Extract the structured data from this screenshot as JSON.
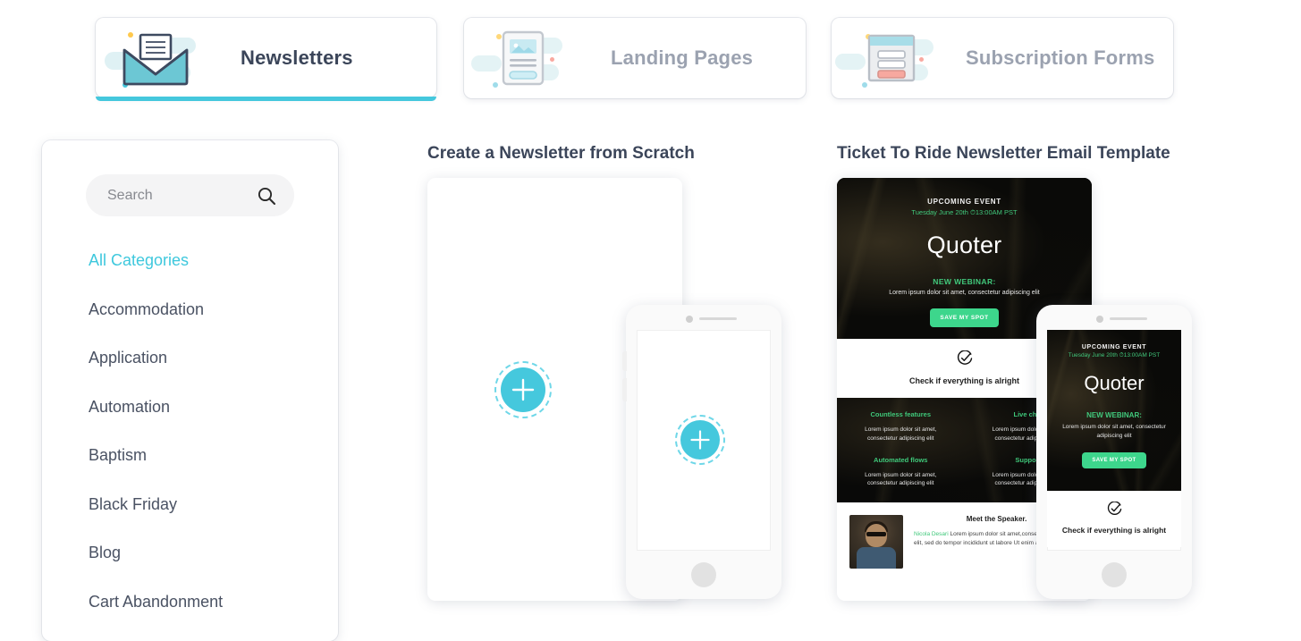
{
  "tabs": [
    {
      "label": "Newsletters",
      "icon": "envelope-icon",
      "active": true
    },
    {
      "label": "Landing Pages",
      "icon": "document-image-icon",
      "active": false
    },
    {
      "label": "Subscription Forms",
      "icon": "form-window-icon",
      "active": false
    }
  ],
  "sidebar": {
    "search": {
      "placeholder": "Search",
      "value": "",
      "icon": "search-icon"
    },
    "categories": [
      {
        "label": "All Categories",
        "active": true
      },
      {
        "label": "Accommodation",
        "active": false
      },
      {
        "label": "Application",
        "active": false
      },
      {
        "label": "Automation",
        "active": false
      },
      {
        "label": "Baptism",
        "active": false
      },
      {
        "label": "Black Friday",
        "active": false
      },
      {
        "label": "Blog",
        "active": false
      },
      {
        "label": "Cart Abandonment",
        "active": false
      }
    ]
  },
  "scratch": {
    "title": "Create a Newsletter from Scratch",
    "add_icon": "plus-icon"
  },
  "template": {
    "title": "Ticket To Ride Newsletter Email Template",
    "hero": {
      "kicker": "UPCOMING EVENT",
      "date": "Tuesday June 20th ⏱13:00AM PST",
      "brand": "Quoter",
      "subheading": "NEW WEBINAR:",
      "lorem": "Lorem ipsum dolor sit amet, consectetur adipiscing elit",
      "cta": "SAVE MY SPOT"
    },
    "check": {
      "icon": "check-circle-icon",
      "text": "Check if everything is alright"
    },
    "features": [
      {
        "heading": "Countless features",
        "body": "Lorem ipsum dolor sit amet, consectetur adipiscing elit"
      },
      {
        "heading": "Live chat",
        "body": "Lorem ipsum dolor sit amet, consectetur adipiscing elit"
      },
      {
        "heading": "Automated flows",
        "body": "Lorem ipsum dolor sit amet, consectetur adipiscing elit"
      },
      {
        "heading": "Support",
        "body": "Lorem ipsum dolor sit amet, consectetur adipiscing elit"
      }
    ],
    "speaker": {
      "heading": "Meet the Speaker.",
      "name": "Nicola Desari",
      "body": " Lorem ipsum dolor sit amet,consectetur adipiscing elit, sed do tempor incididunt ut labore Ut enim ad minim veniam"
    },
    "mobile": {
      "kicker": "UPCOMING EVENT",
      "date": "Tuesday June 20th ⏱13:00AM PST",
      "brand": "Quoter",
      "subheading": "NEW WEBINAR:",
      "lorem": "Lorem ipsum dolor sit amet, consectetur adipiscing elit",
      "cta": "SAVE MY SPOT",
      "check_text": "Check if everything is alright"
    }
  },
  "colors": {
    "accent_cyan": "#45c8dd",
    "accent_green": "#3dd68c",
    "text_dark": "#3b4559",
    "text_muted": "#9ba2b0"
  }
}
